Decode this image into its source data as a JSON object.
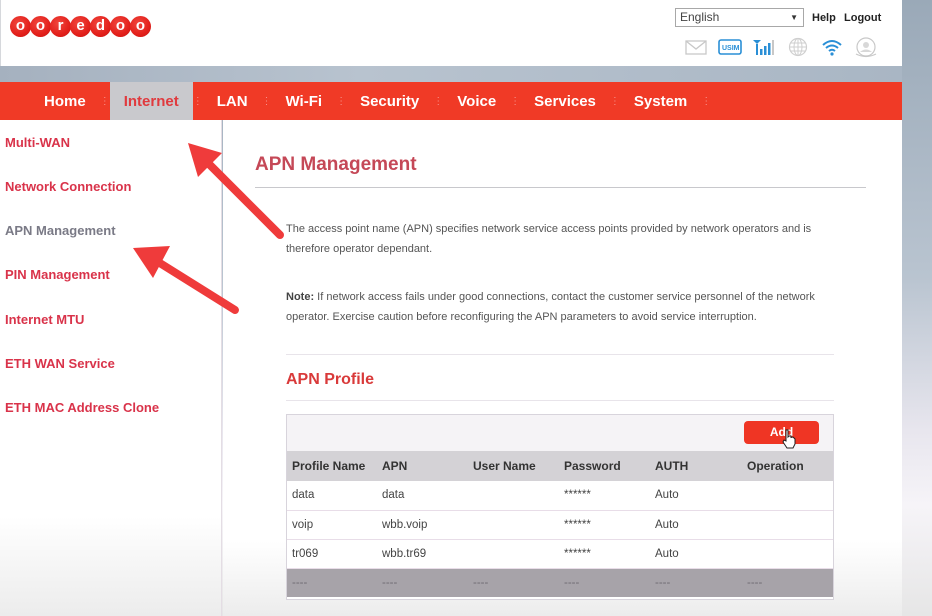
{
  "header": {
    "logo_letters": [
      "o",
      "o",
      "r",
      "e",
      "d",
      "o",
      "o"
    ],
    "logo_text": "ooredoo",
    "language": {
      "selected": "English"
    },
    "links": {
      "help": "Help",
      "logout": "Logout"
    },
    "status_icons": [
      "mail-icon",
      "usim-icon",
      "signal-icon",
      "globe-icon",
      "wifi-icon",
      "user-icon"
    ]
  },
  "nav": {
    "items": [
      {
        "label": "Home",
        "active": false
      },
      {
        "label": "Internet",
        "active": true
      },
      {
        "label": "LAN",
        "active": false
      },
      {
        "label": "Wi-Fi",
        "active": false
      },
      {
        "label": "Security",
        "active": false
      },
      {
        "label": "Voice",
        "active": false
      },
      {
        "label": "Services",
        "active": false
      },
      {
        "label": "System",
        "active": false
      }
    ]
  },
  "sidebar": {
    "items": [
      {
        "label": "Multi-WAN",
        "active": false
      },
      {
        "label": "Network Connection",
        "active": false
      },
      {
        "label": "APN Management",
        "active": true
      },
      {
        "label": "PIN Management",
        "active": false
      },
      {
        "label": "Internet MTU",
        "active": false
      },
      {
        "label": "ETH WAN Service",
        "active": false
      },
      {
        "label": "ETH MAC Address Clone",
        "active": false
      }
    ]
  },
  "main": {
    "title": "APN Management",
    "description": "The access point name (APN) specifies network service access points provided by network operators and is therefore operator dependant.",
    "note_label": "Note:",
    "note_text": " If network access fails under good connections, contact the customer service personnel of the network operator. Exercise caution before reconfiguring the APN parameters to avoid service interruption.",
    "profile_title": "APN Profile",
    "add_label": "Add",
    "table": {
      "headers": [
        "Profile Name",
        "APN",
        "User Name",
        "Password",
        "AUTH",
        "Operation"
      ],
      "rows": [
        [
          "data",
          "data",
          "",
          "******",
          "Auto",
          ""
        ],
        [
          "voip",
          "wbb.voip",
          "",
          "******",
          "Auto",
          ""
        ],
        [
          "tr069",
          "wbb.tr69",
          "",
          "******",
          "Auto",
          ""
        ]
      ],
      "empty_row": [
        "----",
        "----",
        "----",
        "----",
        "----",
        "----"
      ]
    }
  },
  "colors": {
    "brand_red": "#f03a26",
    "link_red": "#d9334a",
    "active_gray": "#7a7a86",
    "annotation_arrow": "#ef3b3b"
  }
}
